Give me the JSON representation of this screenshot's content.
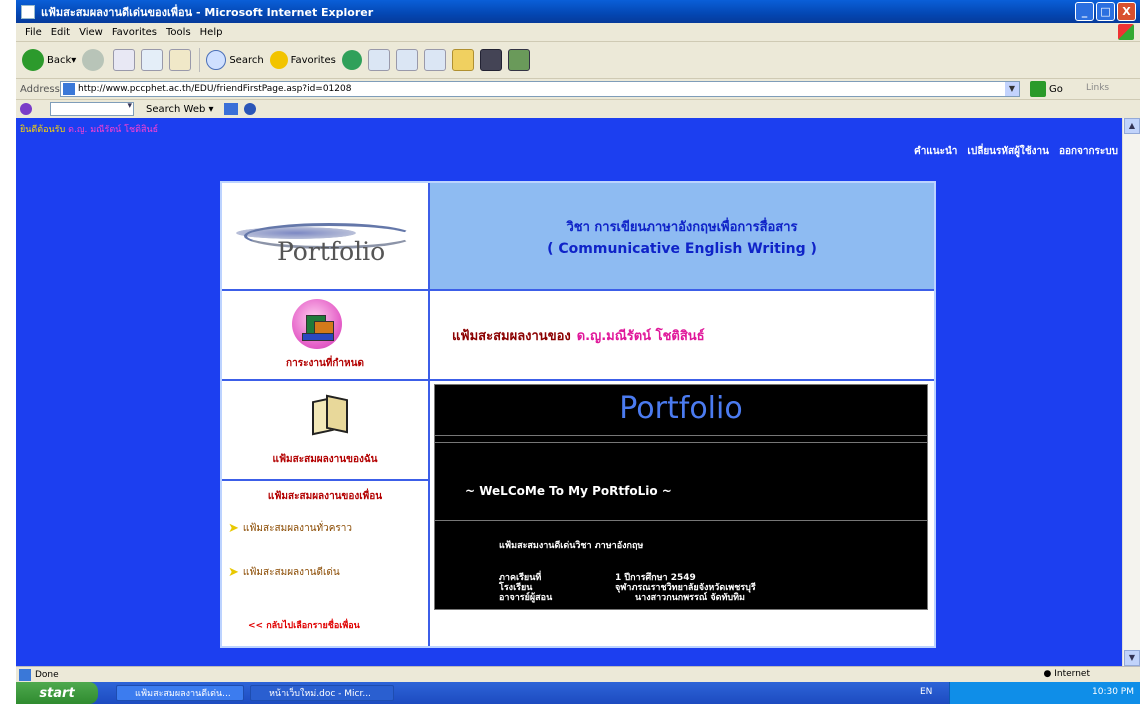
{
  "window": {
    "title": "แฟ้มสะสมผลงานดีเด่นของเพื่อน - Microsoft Internet Explorer",
    "controls": [
      "_",
      "□",
      "X"
    ]
  },
  "menu": [
    "File",
    "Edit",
    "View",
    "Favorites",
    "Tools",
    "Help"
  ],
  "toolbar": {
    "back": "Back",
    "search": "Search",
    "favorites": "Favorites"
  },
  "address": {
    "label": "Address",
    "url": "http://www.pccphet.ac.th/EDU/friendFirstPage.asp?id=01208",
    "go": "Go",
    "links": "Links"
  },
  "searchbar": {
    "search_web": "Search Web"
  },
  "page": {
    "welcome_prefix": "ยินดีต้อนรับ",
    "welcome_name": "ด.ญ. มณีรัตน์ โชติสินธ์",
    "top_nav": [
      "คำแนะนำ",
      "เปลี่ยนรหัสผู้ใช้งาน",
      "ออกจากระบบ"
    ],
    "logo_text": "Portfolio",
    "subject_th": "วิชา การเขียนภาษาอังกฤษเพื่อการสื่อสาร",
    "subject_en": "( Communicative English Writing )",
    "assignments_label": "การะงานที่กำหนด",
    "owner_label": "แฟ้มสะสมผลงานของ",
    "owner_name": "ด.ญ.มณีรัตน์ โชติสินธ์",
    "my_portfolio_label": "แฟ้มสะสมผลงานของฉัน",
    "friends_header": "แฟ้มสะสมผลงานของเพื่อน",
    "friends_items": [
      "แฟ้มสะสมผลงานทั่วคราว",
      "แฟ้มสะสมผลงานดีเด่น"
    ],
    "back_link": "<< กลับไปเลือกรายชื่อเพื่อน",
    "portfolio_title": "Portfolio",
    "welcome_banner": "~ WeLCoMe To My PoRtfoLio ~",
    "info_heading": "แฟ้มสะสมงานดีเด่นวิชา  ภาษาอังกฤษ",
    "info_labels": [
      "ภาคเรียนที่",
      "โรงเรียน",
      "อาจารย์ผู้สอน"
    ],
    "info_values": [
      "1  ปีการศึกษา 2549",
      "จุฬาภรณราชวิทยาลัยจังหวัดเพชรบุรี",
      "นางสาวกนกพรรณ์ จัดทับทิม"
    ]
  },
  "status": {
    "left": "Done",
    "zone": "Internet"
  },
  "taskbar": {
    "start": "start",
    "tasks": [
      "แฟ้มสะสมผลงานดีเด่น...",
      "หน้าเว็บใหม่.doc - Micr..."
    ],
    "lang": "EN",
    "clock": "10:30 PM"
  },
  "colors": {
    "page_bg": "#1c3ff0",
    "header_bg": "#8ebbf2",
    "accent_red": "#b30000",
    "accent_pink": "#e0179a",
    "portfolio_blue": "#4b7bf0"
  }
}
